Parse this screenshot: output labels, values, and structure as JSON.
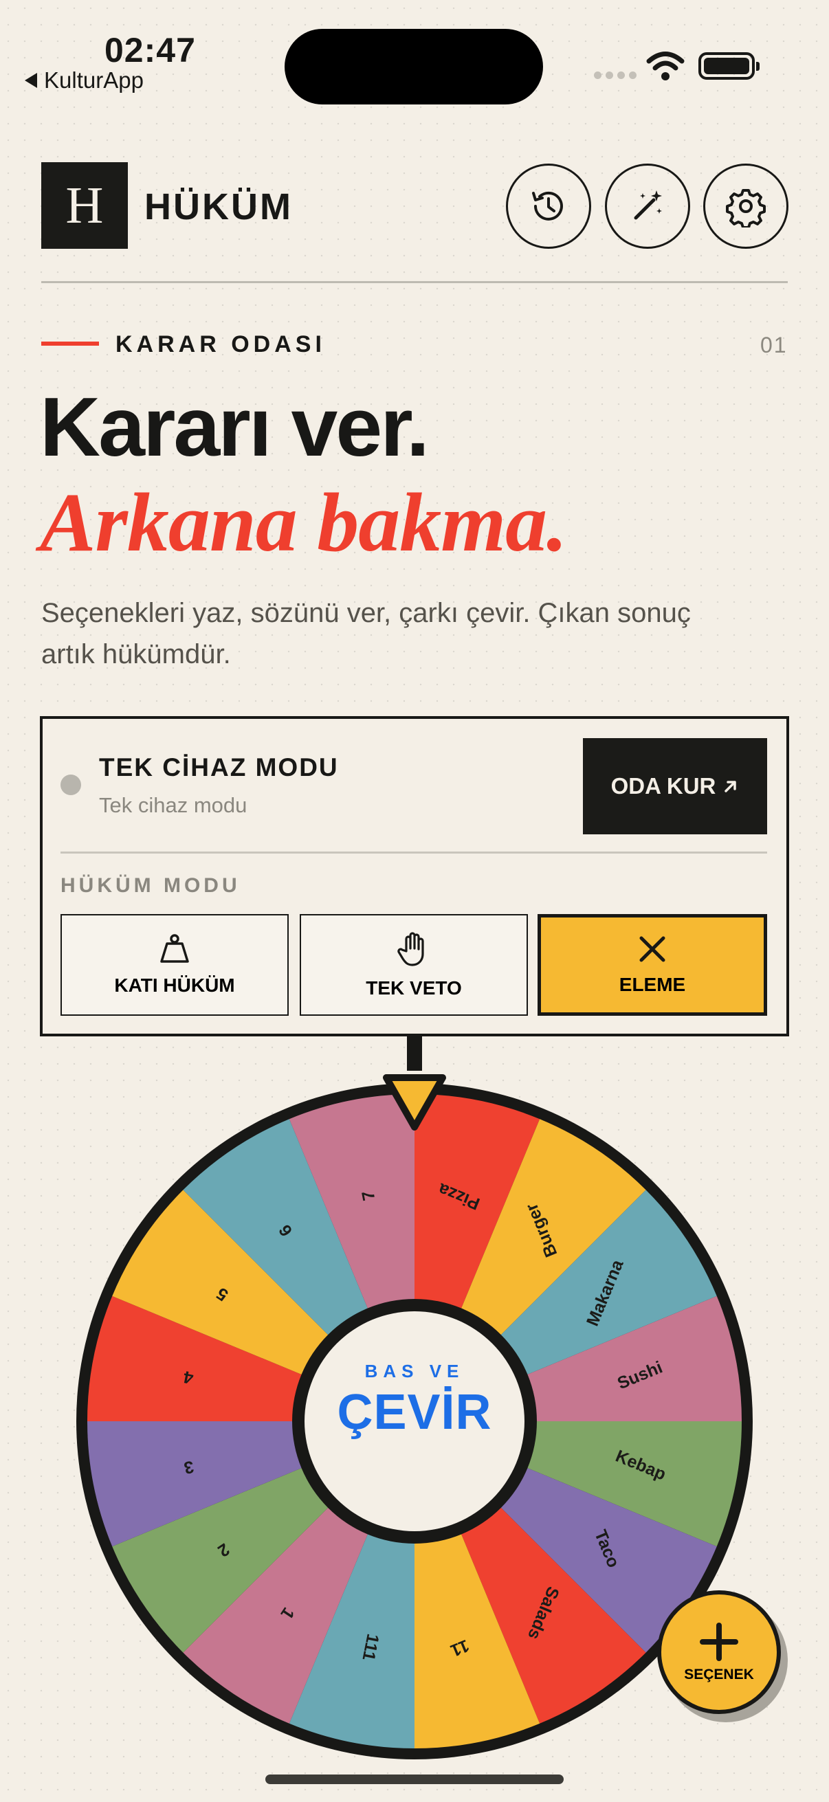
{
  "status_bar": {
    "time": "02:47",
    "back_app": "KulturApp"
  },
  "header": {
    "logo_letter": "H",
    "brand": "HÜKÜM"
  },
  "section": {
    "kicker": "KARAR ODASI",
    "number": "01"
  },
  "hero": {
    "title": "Kararı ver.",
    "subtitle": "Arkana bakma.",
    "description": "Seçenekleri yaz, sözünü ver, çarkı çevir. Çıkan sonuç artık hükümdür."
  },
  "device_mode": {
    "title": "TEK CİHAZ MODU",
    "subtitle": "Tek cihaz modu",
    "button": "ODA KUR"
  },
  "hukum_modu": {
    "label": "HÜKÜM MODU",
    "options": [
      {
        "label": "KATI HÜKÜM",
        "icon": "weight-icon",
        "active": false
      },
      {
        "label": "TEK VETO",
        "icon": "hand-icon",
        "active": false
      },
      {
        "label": "ELEME",
        "icon": "x-icon",
        "active": true
      }
    ]
  },
  "wheel": {
    "center_small": "BAS VE",
    "center_big": "ÇEVİR",
    "segments": [
      {
        "label": "Pizza",
        "color": "#ef4130"
      },
      {
        "label": "Burger",
        "color": "#f6b932"
      },
      {
        "label": "Makarna",
        "color": "#6aa8b4"
      },
      {
        "label": "Sushi",
        "color": "#c67790"
      },
      {
        "label": "Kebap",
        "color": "#80a566"
      },
      {
        "label": "Taco",
        "color": "#836fae"
      },
      {
        "label": "Salads",
        "color": "#ef4130"
      },
      {
        "label": "11",
        "color": "#f6b932"
      },
      {
        "label": "111",
        "color": "#6aa8b4"
      },
      {
        "label": "1",
        "color": "#c67790"
      },
      {
        "label": "2",
        "color": "#80a566"
      },
      {
        "label": "3",
        "color": "#836fae"
      },
      {
        "label": "4",
        "color": "#ef4130"
      },
      {
        "label": "5",
        "color": "#f6b932"
      },
      {
        "label": "6",
        "color": "#6aa8b4"
      },
      {
        "label": "7",
        "color": "#c67790"
      }
    ]
  },
  "fab": {
    "label": "SEÇENEK"
  }
}
